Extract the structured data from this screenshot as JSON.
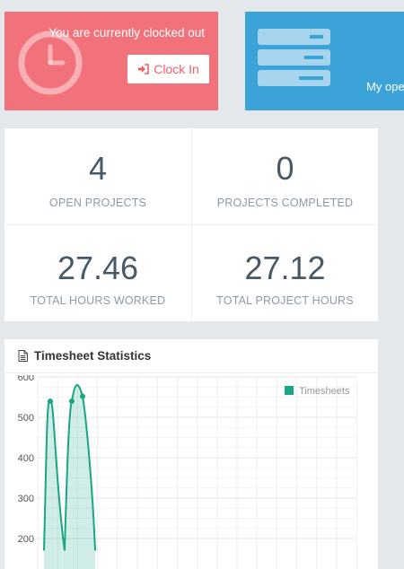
{
  "clock_card": {
    "status_text": "You are currently clocked out",
    "button_label": "Clock In",
    "background": "#f1727a"
  },
  "projects_card": {
    "label": "My open",
    "background": "#3ca3d9"
  },
  "stats": [
    {
      "value": "4",
      "label": "OPEN PROJECTS"
    },
    {
      "value": "0",
      "label": "PROJECTS COMPLETED"
    },
    {
      "value": "27.46",
      "label": "TOTAL HOURS WORKED"
    },
    {
      "value": "27.12",
      "label": "TOTAL PROJECT HOURS"
    }
  ],
  "timesheet_panel": {
    "title": "Timesheet Statistics"
  },
  "chart_data": {
    "type": "area",
    "title": "Timesheet Statistics",
    "legend": {
      "entries": [
        "Timesheets"
      ],
      "placement": "top-right"
    },
    "ylim": [
      180,
      620
    ],
    "yticks": [
      200,
      300,
      400,
      500,
      600
    ],
    "grid": true,
    "color": "#1aa585",
    "series": [
      {
        "name": "Timesheets",
        "points": [
          {
            "x": 0,
            "y": 170
          },
          {
            "x": 1,
            "y": 540
          },
          {
            "x": 2,
            "y": 170
          },
          {
            "x": 3,
            "y": 540
          },
          {
            "x": 4,
            "y": 552
          },
          {
            "x": 5,
            "y": 170
          }
        ]
      }
    ]
  }
}
